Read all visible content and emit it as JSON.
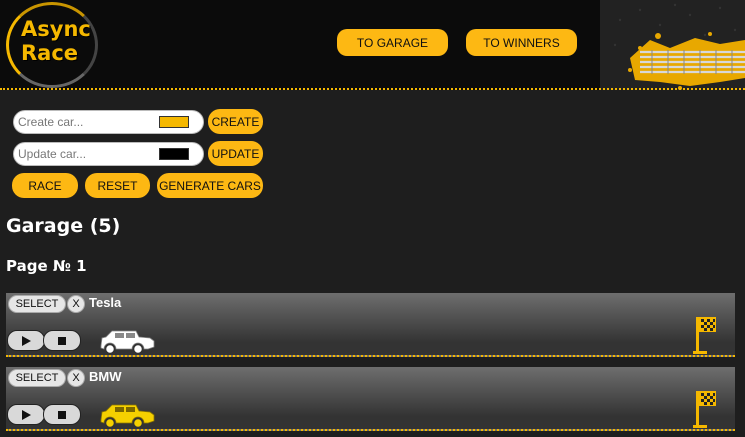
{
  "header": {
    "logo_line1": "Async",
    "logo_line2": "Race",
    "nav": {
      "garage_label": "TO GARAGE",
      "winners_label": "TO WINNERS"
    }
  },
  "controls": {
    "create": {
      "placeholder": "Create car...",
      "color": "#f5b800",
      "button_label": "CREATE"
    },
    "update": {
      "placeholder": "Update car...",
      "color": "#000000",
      "button_label": "UPDATE"
    },
    "race_label": "RACE",
    "reset_label": "RESET",
    "generate_label": "GENERATE CARS"
  },
  "garage": {
    "title": "Garage (5)",
    "page_label": "Page № 1",
    "select_label": "SELECT",
    "remove_label": "X",
    "cars": [
      {
        "name": "Tesla",
        "color": "#ffffff",
        "icon": "car-icon"
      },
      {
        "name": "BMW",
        "color": "#f5d000",
        "icon": "car-icon"
      }
    ]
  },
  "theme": {
    "accent": "#fdb813",
    "background": "#1e1e1e"
  }
}
